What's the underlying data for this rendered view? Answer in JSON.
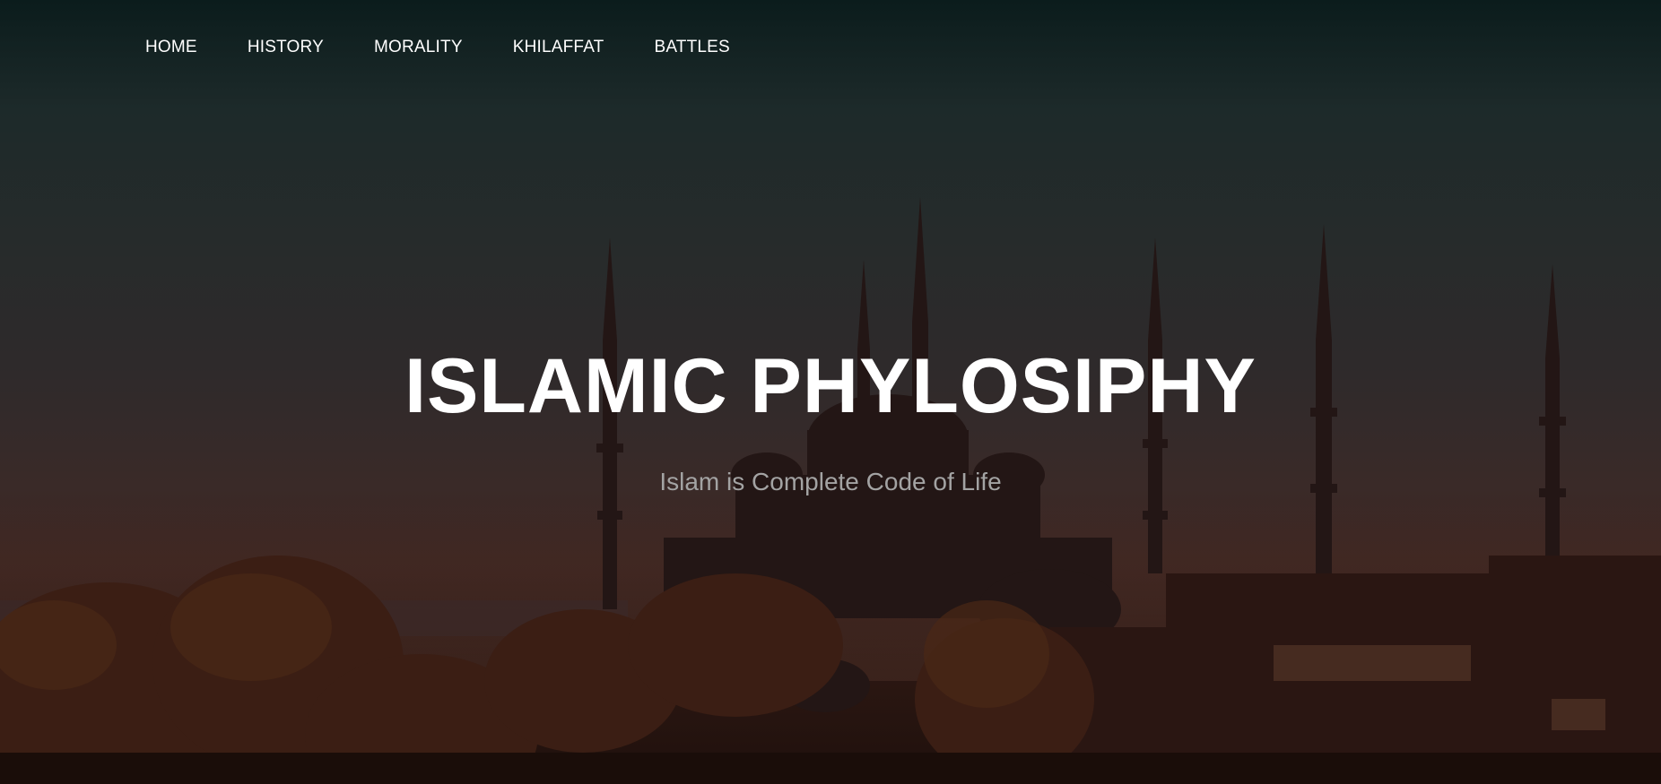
{
  "nav": {
    "items": [
      {
        "label": "HOME"
      },
      {
        "label": "HISTORY"
      },
      {
        "label": "MORALITY"
      },
      {
        "label": "KHILAFFAT"
      },
      {
        "label": "BATTLES"
      }
    ]
  },
  "hero": {
    "title": "ISLAMIC PHYLOSIPHY",
    "subtitle": "Islam is Complete Code of Life",
    "background": "mosque-silhouette-sunset-image"
  },
  "colors": {
    "nav_text": "#ffffff",
    "title_text": "#ffffff",
    "subtitle_text": "#a3a3a3",
    "sky_top": "#0b1c1c",
    "sky_bottom": "#3d2520"
  }
}
